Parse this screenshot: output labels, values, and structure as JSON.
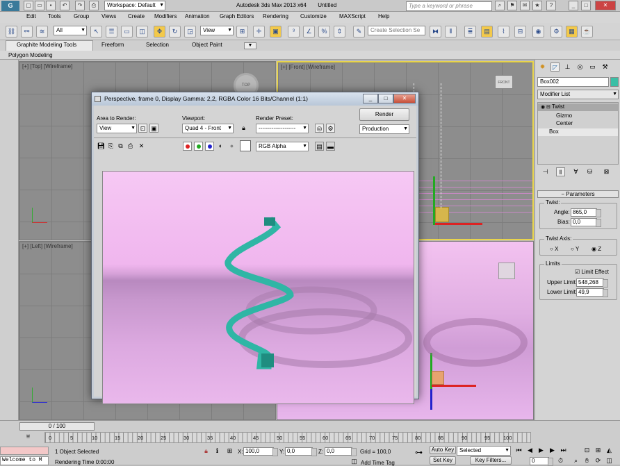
{
  "window": {
    "title": "Autodesk 3ds Max 2013 x64",
    "document": "Untitled",
    "workspace": "Workspace: Default",
    "search_placeholder": "Type a keyword or phrase"
  },
  "menu": [
    "Edit",
    "Tools",
    "Group",
    "Views",
    "Create",
    "Modifiers",
    "Animation",
    "Graph Editors",
    "Rendering",
    "Customize",
    "MAXScript",
    "Help"
  ],
  "toolbar": {
    "selection_filter": "All",
    "ref_coord": "View",
    "selection_set_placeholder": "Create Selection Se"
  },
  "ribbon": {
    "tabs": [
      "Graphite Modeling Tools",
      "Freeform",
      "Selection",
      "Object Paint"
    ],
    "sub": "Polygon Modeling"
  },
  "viewports": {
    "top": "[+] [Top] [Wireframe]",
    "front": "[+] [Front] [Wireframe]",
    "left": "[+] [Left] [Wireframe]",
    "viewcube_top": "TOP",
    "viewcube_front": "FRONT"
  },
  "render_dialog": {
    "title": "Perspective, frame 0, Display Gamma: 2,2, RGBA Color 16 Bits/Channel (1:1)",
    "area_label": "Area to Render:",
    "area_value": "View",
    "viewport_label": "Viewport:",
    "viewport_value": "Quad 4 - Front",
    "preset_label": "Render Preset:",
    "preset_value": "--------------------",
    "render_button": "Render",
    "production_value": "Production",
    "channel_value": "RGB Alpha"
  },
  "command_panel": {
    "object_name": "Box002",
    "modifier_list": "Modifier List",
    "stack": [
      "Twist",
      "Gizmo",
      "Center",
      "Box"
    ],
    "parameters_title": "Parameters",
    "twist_group": "Twist:",
    "angle_label": "Angle:",
    "angle_value": "865,0",
    "bias_label": "Bias:",
    "bias_value": "0,0",
    "axis_group": "Twist Axis:",
    "axes": [
      "X",
      "Y",
      "Z"
    ],
    "limits_group": "Limits",
    "limit_effect": "Limit Effect",
    "upper_label": "Upper Limit:",
    "upper_value": "548,268",
    "lower_label": "Lower Limit:",
    "lower_value": "49,9"
  },
  "timeline": {
    "frame": "0 / 100",
    "ticks": [
      "0",
      "5",
      "10",
      "15",
      "20",
      "25",
      "30",
      "35",
      "40",
      "45",
      "50",
      "55",
      "60",
      "65",
      "70",
      "75",
      "80",
      "85",
      "90",
      "95",
      "100"
    ]
  },
  "status": {
    "welcome": "Welcome to M",
    "selected": "1 Object Selected",
    "rendering_time": "Rendering Time  0:00:00",
    "x_label": "X:",
    "x_value": "100,0",
    "y_label": "Y:",
    "y_value": "0,0",
    "z_label": "Z:",
    "z_value": "0,0",
    "grid": "Grid = 100,0",
    "add_time_tag": "Add Time Tag",
    "auto_key": "Auto Key",
    "set_key": "Set Key",
    "selected_dropdown": "Selected",
    "key_filters": "Key Filters...",
    "current_frame": "0"
  }
}
